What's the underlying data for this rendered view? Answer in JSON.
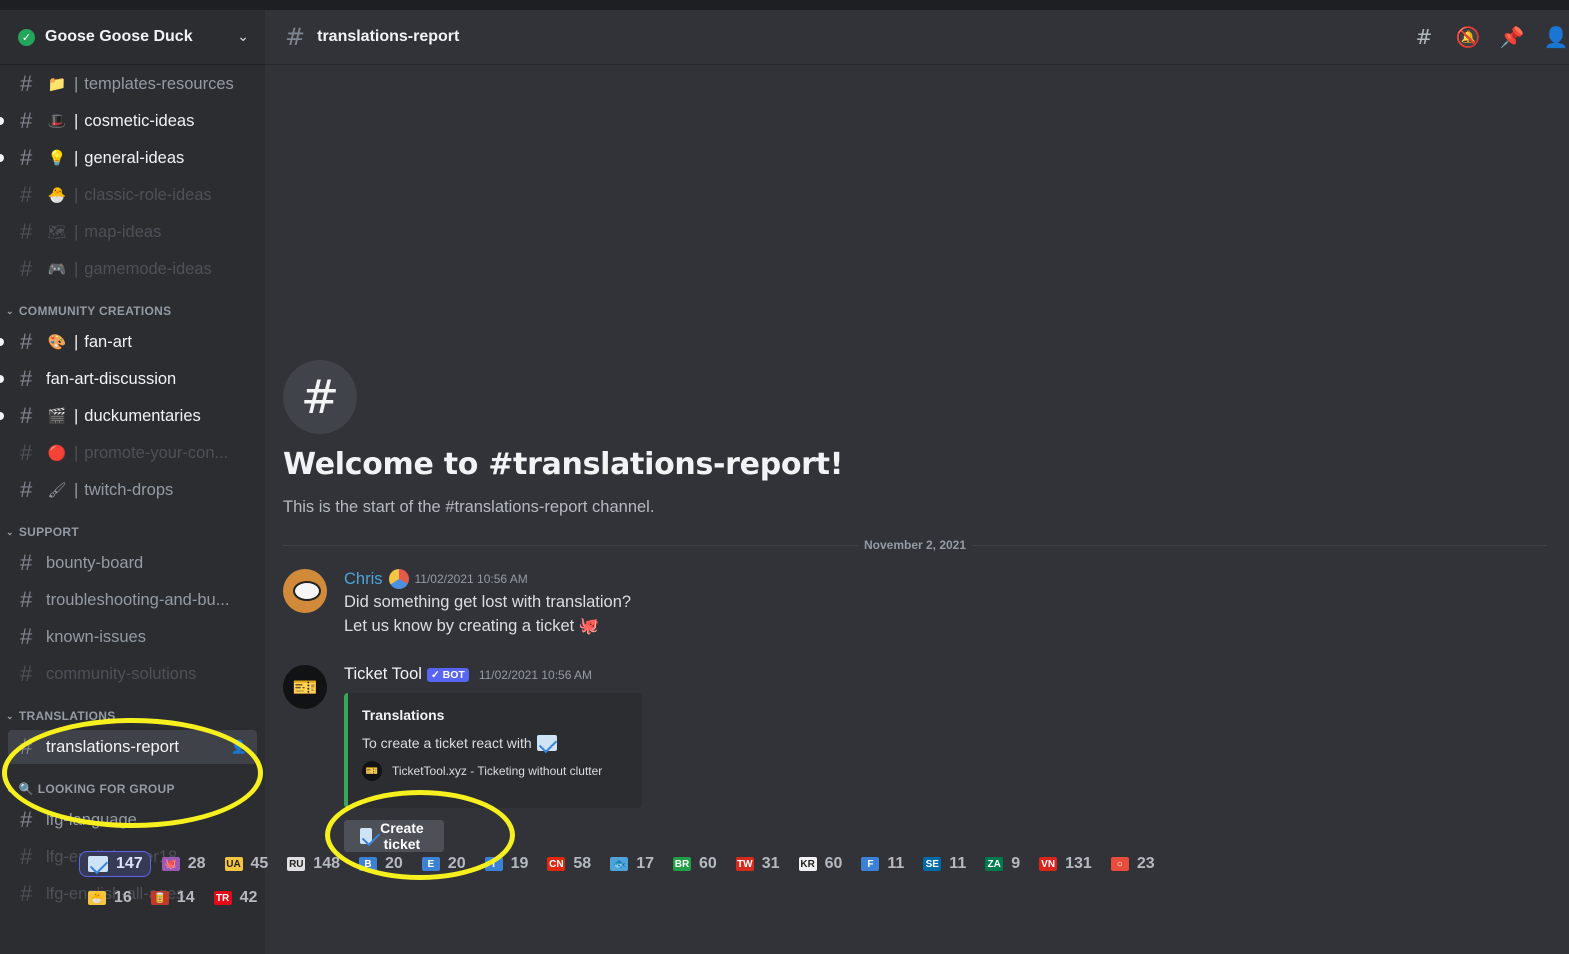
{
  "server": {
    "name": "Goose Goose Duck"
  },
  "sidebar": {
    "channels_top": [
      {
        "emoji": "📁",
        "label": "templates-resources",
        "state": "normal",
        "sep": "|"
      },
      {
        "emoji": "🎩",
        "label": "cosmetic-ideas",
        "state": "unread",
        "sep": "|"
      },
      {
        "emoji": "💡",
        "label": "general-ideas",
        "state": "unread",
        "sep": "|"
      },
      {
        "emoji": "🐣",
        "label": "classic-role-ideas",
        "state": "muted",
        "sep": "|"
      },
      {
        "emoji": "🗺",
        "label": "map-ideas",
        "state": "muted",
        "sep": "|"
      },
      {
        "emoji": "🎮",
        "label": "gamemode-ideas",
        "state": "muted",
        "sep": "|"
      }
    ],
    "community": {
      "label": "COMMUNITY CREATIONS",
      "channels": [
        {
          "emoji": "🎨",
          "label": "fan-art",
          "state": "unread",
          "sep": "|"
        },
        {
          "emoji": "",
          "label": "fan-art-discussion",
          "state": "unread",
          "sep": ""
        },
        {
          "emoji": "🎬",
          "label": "duckumentaries",
          "state": "unread",
          "sep": "|"
        },
        {
          "emoji": "🔴",
          "label": "promote-your-con...",
          "state": "muted",
          "sep": "|"
        },
        {
          "emoji": "🖌",
          "label": "twitch-drops",
          "state": "normal",
          "sep": "|"
        }
      ]
    },
    "support": {
      "label": "SUPPORT",
      "channels": [
        {
          "label": "bounty-board",
          "state": "normal"
        },
        {
          "label": "troubleshooting-and-bu...",
          "state": "normal"
        },
        {
          "label": "known-issues",
          "state": "normal"
        },
        {
          "label": "community-solutions",
          "state": "muted"
        }
      ]
    },
    "translations": {
      "label": "TRANSLATIONS",
      "channels": [
        {
          "label": "translations-report",
          "state": "selected"
        }
      ]
    },
    "lfg": {
      "label": "🔍 LOOKING FOR GROUP",
      "channels": [
        {
          "label": "lfg-language",
          "state": "normal"
        },
        {
          "label": "lfg-english-over18",
          "state": "muted"
        },
        {
          "label": "lfg-english-all-ages",
          "state": "muted"
        }
      ]
    }
  },
  "topbar": {
    "channel": "translations-report"
  },
  "welcome": {
    "title": "Welcome to #translations-report!",
    "subtitle": "This is the start of the #translations-report channel."
  },
  "divider_date": "November 2, 2021",
  "messages": {
    "chris": {
      "author": "Chris",
      "author_color": "#4ea3d8",
      "timestamp": "11/02/2021 10:56 AM",
      "line1": "Did something get lost with translation?",
      "line2": "Let us know by creating a ticket 🐙"
    },
    "tickettool": {
      "author": "Ticket Tool",
      "bot_tag": "✓ BOT",
      "timestamp": "11/02/2021 10:56 AM",
      "embed_title": "Translations",
      "embed_desc": "To create a ticket react with",
      "embed_footer": "TicketTool.xyz - Ticketing without clutter",
      "button_label": "Create ticket"
    }
  },
  "reactions": [
    {
      "emoji": "env",
      "count": "147",
      "me": true,
      "color": "#cfe3f7"
    },
    {
      "emoji": "🐙",
      "count": "28",
      "color": "#9b59b6"
    },
    {
      "emoji": "UA",
      "count": "45",
      "color": "#f4c542"
    },
    {
      "emoji": "RU",
      "count": "148",
      "color": "#e0e0e0"
    },
    {
      "emoji": "B",
      "count": "20",
      "color": "#3b82d6"
    },
    {
      "emoji": "E",
      "count": "20",
      "color": "#3b82d6"
    },
    {
      "emoji": "T",
      "count": "19",
      "color": "#3b82d6"
    },
    {
      "emoji": "CN",
      "count": "58",
      "color": "#de2910"
    },
    {
      "emoji": "🐟",
      "count": "17",
      "color": "#4ea3d8"
    },
    {
      "emoji": "BR",
      "count": "60",
      "color": "#229e45"
    },
    {
      "emoji": "TW",
      "count": "31",
      "color": "#d52b1e"
    },
    {
      "emoji": "KR",
      "count": "60",
      "color": "#f2f2f2"
    },
    {
      "emoji": "F",
      "count": "11",
      "color": "#3b82d6"
    },
    {
      "emoji": "SE",
      "count": "11",
      "color": "#006aa7"
    },
    {
      "emoji": "ZA",
      "count": "9",
      "color": "#007a4d"
    },
    {
      "emoji": "VN",
      "count": "131",
      "color": "#da251d"
    },
    {
      "emoji": "○",
      "count": "23",
      "color": "#e74c3c"
    },
    {
      "emoji": "🐣",
      "count": "16",
      "color": "#f4c542"
    },
    {
      "emoji": "🥫",
      "count": "14",
      "color": "#c0392b"
    },
    {
      "emoji": "TR",
      "count": "42",
      "color": "#e30a17"
    }
  ]
}
